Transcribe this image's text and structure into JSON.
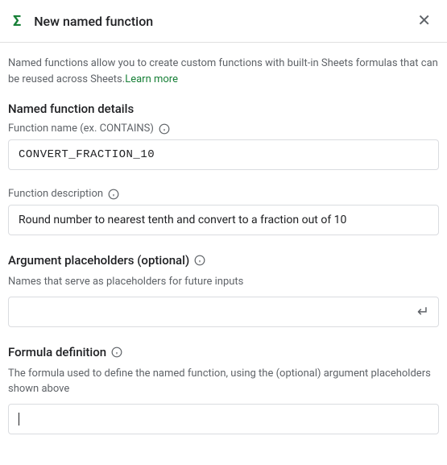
{
  "header": {
    "title": "New named function"
  },
  "intro": {
    "text": "Named functions allow you to create custom functions with built-in Sheets formulas that can be reused across Sheets.",
    "learn_more": "Learn more"
  },
  "details": {
    "section_title": "Named function details",
    "name_label": "Function name (ex. CONTAINS)",
    "name_value": "CONVERT_FRACTION_10",
    "description_label": "Function description",
    "description_value": "Round number to nearest tenth and convert to a fraction out of 10"
  },
  "arguments": {
    "section_title": "Argument placeholders (optional)",
    "helper": "Names that serve as placeholders for future inputs",
    "value": ""
  },
  "formula": {
    "section_title": "Formula definition",
    "helper": "The formula used to define the named function, using the (optional) argument placeholders shown above",
    "value": ""
  }
}
